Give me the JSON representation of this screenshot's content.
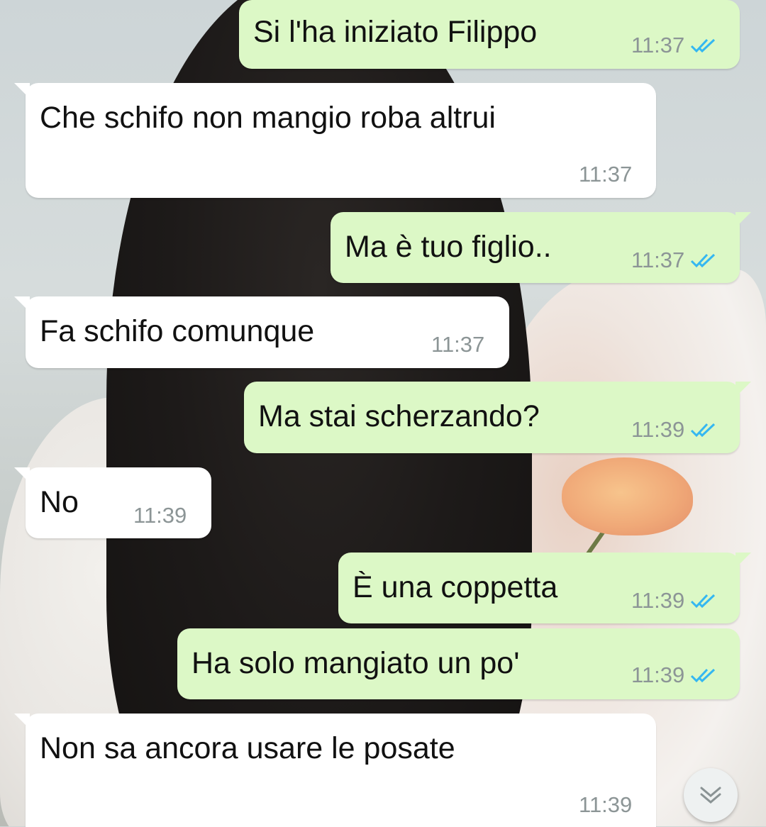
{
  "chat": {
    "messages": [
      {
        "direction": "out",
        "text": "Si l'ha iniziato Filippo",
        "time": "11:37",
        "status": "read"
      },
      {
        "direction": "in",
        "text": "Che schifo non mangio roba altrui",
        "time": "11:37"
      },
      {
        "direction": "out",
        "text": "Ma è tuo figlio..",
        "time": "11:37",
        "status": "read"
      },
      {
        "direction": "in",
        "text": "Fa schifo comunque",
        "time": "11:37"
      },
      {
        "direction": "out",
        "text": "Ma stai scherzando?",
        "time": "11:39",
        "status": "read"
      },
      {
        "direction": "in",
        "text": "No",
        "time": "11:39"
      },
      {
        "direction": "out",
        "text": "È una coppetta",
        "time": "11:39",
        "status": "read"
      },
      {
        "direction": "out",
        "text": "Ha solo mangiato un po'",
        "time": "11:39",
        "status": "read"
      },
      {
        "direction": "in",
        "text": "Non sa ancora usare le posate",
        "time": "11:39"
      }
    ]
  },
  "controls": {
    "scroll_down_icon": "double-chevron-down-icon"
  },
  "colors": {
    "outgoing_bubble": "#dcf8c6",
    "incoming_bubble": "#ffffff",
    "read_ticks": "#34b7f1",
    "timestamp": "#8c9596"
  }
}
